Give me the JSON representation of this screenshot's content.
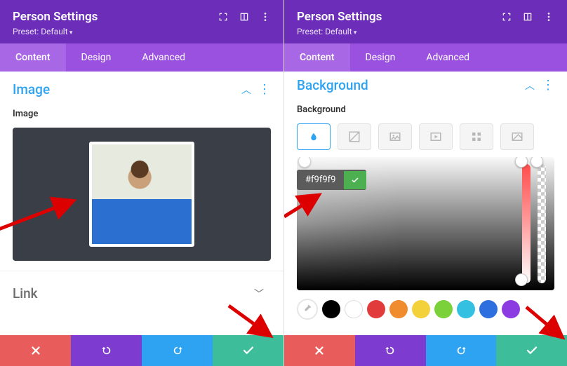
{
  "left": {
    "header": {
      "title": "Person Settings",
      "preset": "Preset: Default"
    },
    "tabs": [
      "Content",
      "Design",
      "Advanced"
    ],
    "activeTab": "Content",
    "section_image": {
      "title": "Image",
      "field_label": "Image"
    },
    "section_link": {
      "title": "Link"
    }
  },
  "right": {
    "header": {
      "title": "Person Settings",
      "preset": "Preset: Default"
    },
    "tabs": [
      "Content",
      "Design",
      "Advanced"
    ],
    "activeTab": "Content",
    "section_bg": {
      "title": "Background",
      "field_label": "Background"
    },
    "hex": "#f9f9f9",
    "swatches": [
      "#000000",
      "#ffffff",
      "#e23b3b",
      "#f08c2e",
      "#f2d13a",
      "#7bd13a",
      "#34c0e0",
      "#2e6fe0",
      "#8c3be2"
    ]
  }
}
